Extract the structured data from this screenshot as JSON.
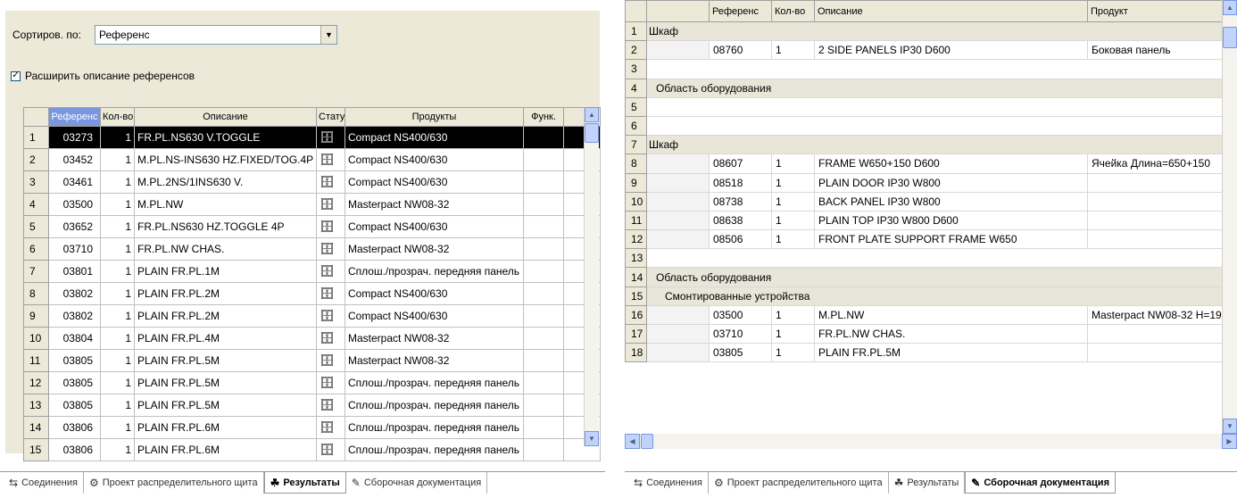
{
  "left": {
    "sort_label": "Сортиров. по:",
    "sort_value": "Референс",
    "expand_label": "Расширить описание референсов",
    "expand_checked": "✓",
    "columns": [
      "",
      "Референс",
      "Кол-во",
      "Описание",
      "Стату",
      "Продукты",
      "Функ."
    ],
    "rows": [
      {
        "n": "1",
        "ref": "03273",
        "qty": "1",
        "desc": "FR.PL.NS630 V.TOGGLE",
        "prod": "Compact NS400/630"
      },
      {
        "n": "2",
        "ref": "03452",
        "qty": "1",
        "desc": "M.PL.NS-INS630 HZ.FIXED/TOG.4P",
        "prod": "Compact NS400/630"
      },
      {
        "n": "3",
        "ref": "03461",
        "qty": "1",
        "desc": "M.PL.2NS/1INS630 V.",
        "prod": "Compact NS400/630"
      },
      {
        "n": "4",
        "ref": "03500",
        "qty": "1",
        "desc": "M.PL.NW",
        "prod": "Masterpact NW08-32"
      },
      {
        "n": "5",
        "ref": "03652",
        "qty": "1",
        "desc": "FR.PL.NS630 HZ.TOGGLE 4P",
        "prod": "Compact NS400/630"
      },
      {
        "n": "6",
        "ref": "03710",
        "qty": "1",
        "desc": "FR.PL.NW CHAS.",
        "prod": "Masterpact NW08-32"
      },
      {
        "n": "7",
        "ref": "03801",
        "qty": "1",
        "desc": "PLAIN FR.PL.1M",
        "prod": "Сплош./прозрач. передняя панель"
      },
      {
        "n": "8",
        "ref": "03802",
        "qty": "1",
        "desc": "PLAIN FR.PL.2M",
        "prod": "Compact NS400/630"
      },
      {
        "n": "9",
        "ref": "03802",
        "qty": "1",
        "desc": "PLAIN FR.PL.2M",
        "prod": "Compact NS400/630"
      },
      {
        "n": "10",
        "ref": "03804",
        "qty": "1",
        "desc": "PLAIN FR.PL.4M",
        "prod": "Masterpact NW08-32"
      },
      {
        "n": "11",
        "ref": "03805",
        "qty": "1",
        "desc": "PLAIN FR.PL.5M",
        "prod": "Masterpact NW08-32"
      },
      {
        "n": "12",
        "ref": "03805",
        "qty": "1",
        "desc": "PLAIN FR.PL.5M",
        "prod": "Сплош./прозрач. передняя панель"
      },
      {
        "n": "13",
        "ref": "03805",
        "qty": "1",
        "desc": "PLAIN FR.PL.5M",
        "prod": "Сплош./прозрач. передняя панель"
      },
      {
        "n": "14",
        "ref": "03806",
        "qty": "1",
        "desc": "PLAIN FR.PL.6M",
        "prod": "Сплош./прозрач. передняя панель"
      },
      {
        "n": "15",
        "ref": "03806",
        "qty": "1",
        "desc": "PLAIN FR.PL.6M",
        "prod": "Сплош./прозрач. передняя панель"
      }
    ],
    "tabs": [
      "Соединения",
      "Проект распределительного щита",
      "Результаты",
      "Сборочная документация"
    ]
  },
  "right": {
    "columns": [
      "",
      "",
      "Референс",
      "Кол-во",
      "Описание",
      "Продукт"
    ],
    "rows": [
      {
        "n": "1",
        "type": "hdr",
        "kind": "group",
        "label": "Шкаф"
      },
      {
        "n": "2",
        "type": "item",
        "ref": "08760",
        "qty": "1",
        "desc": "2 SIDE PANELS IP30 D600",
        "prod": "Боковая панель"
      },
      {
        "n": "3",
        "type": "blank"
      },
      {
        "n": "4",
        "type": "hdr",
        "kind": "area",
        "label": "Область оборудования"
      },
      {
        "n": "5",
        "type": "blank"
      },
      {
        "n": "6",
        "type": "blank"
      },
      {
        "n": "7",
        "type": "hdr",
        "kind": "group",
        "label": "Шкаф"
      },
      {
        "n": "8",
        "type": "item",
        "ref": "08607",
        "qty": "1",
        "desc": "FRAME W650+150 D600",
        "prod": "Ячейка Длина=650+150"
      },
      {
        "n": "9",
        "type": "item",
        "ref": "08518",
        "qty": "1",
        "desc": "PLAIN DOOR IP30 W800",
        "prod": ""
      },
      {
        "n": "10",
        "type": "item",
        "ref": "08738",
        "qty": "1",
        "desc": "BACK PANEL IP30 W800",
        "prod": ""
      },
      {
        "n": "11",
        "type": "item",
        "ref": "08638",
        "qty": "1",
        "desc": "PLAIN TOP IP30 W800 D600",
        "prod": ""
      },
      {
        "n": "12",
        "type": "item",
        "ref": "08506",
        "qty": "1",
        "desc": "FRONT PLATE SUPPORT FRAME W650",
        "prod": ""
      },
      {
        "n": "13",
        "type": "blank"
      },
      {
        "n": "14",
        "type": "hdr",
        "kind": "area",
        "label": "Область оборудования"
      },
      {
        "n": "15",
        "type": "hdr",
        "kind": "sub",
        "label": "Смонтированные устройства"
      },
      {
        "n": "16",
        "type": "item",
        "ref": "03500",
        "qty": "1",
        "desc": "M.PL.NW",
        "prod": "Masterpact NW08-32  H=19"
      },
      {
        "n": "17",
        "type": "item",
        "ref": "03710",
        "qty": "1",
        "desc": "FR.PL.NW CHAS.",
        "prod": ""
      },
      {
        "n": "18",
        "type": "item",
        "ref": "03805",
        "qty": "1",
        "desc": "PLAIN FR.PL.5M",
        "prod": ""
      }
    ],
    "tabs": [
      "Соединения",
      "Проект распределительного щита",
      "Результаты",
      "Сборочная документация"
    ]
  }
}
